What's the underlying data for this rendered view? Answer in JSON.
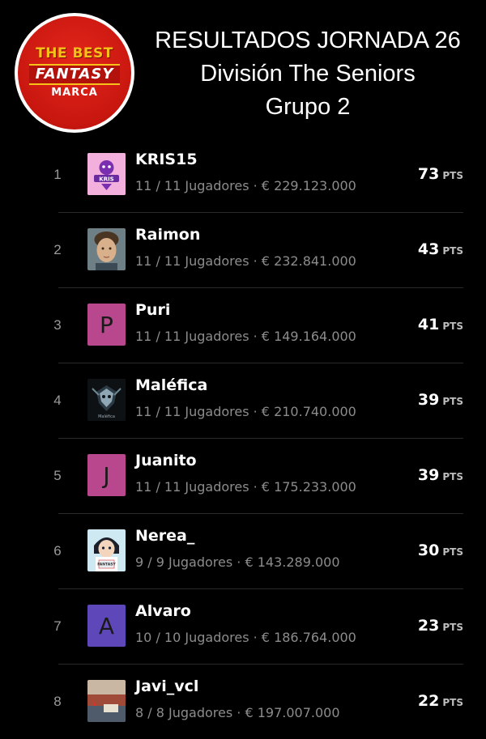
{
  "logo": {
    "line1": "THE BEST",
    "line2": "FANTASY",
    "line3": "MARCA"
  },
  "header": {
    "line1": "RESULTADOS JORNADA 26",
    "line2": "División The Seniors",
    "line3": "Grupo 2"
  },
  "pts_unit": "PTS",
  "rows": [
    {
      "rank": "1",
      "name": "KRIS15",
      "meta": "11 / 11 Jugadores · € 229.123.000",
      "points": "73",
      "avatar": "kris-logo-icon"
    },
    {
      "rank": "2",
      "name": "Raimon",
      "meta": "11 / 11 Jugadores · € 232.841.000",
      "points": "43",
      "avatar": "boy-photo-icon"
    },
    {
      "rank": "3",
      "name": "Puri",
      "meta": "11 / 11 Jugadores · € 149.164.000",
      "points": "41",
      "avatar_letter": "P"
    },
    {
      "rank": "4",
      "name": "Maléfica",
      "meta": "11 / 11 Jugadores · € 210.740.000",
      "points": "39",
      "avatar": "dark-emblem-icon"
    },
    {
      "rank": "5",
      "name": "Juanito",
      "meta": "11 / 11 Jugadores · € 175.233.000",
      "points": "39",
      "avatar_letter": "J"
    },
    {
      "rank": "6",
      "name": "Nerea_",
      "meta": "9 / 9 Jugadores · € 143.289.000",
      "points": "30",
      "avatar": "anime-girl-icon"
    },
    {
      "rank": "7",
      "name": "Alvaro",
      "meta": "10 / 10 Jugadores · € 186.764.000",
      "points": "23",
      "avatar_letter": "A"
    },
    {
      "rank": "8",
      "name": "Javi_vcl",
      "meta": "8 / 8 Jugadores · € 197.007.000",
      "points": "22",
      "avatar": "stadium-photo-icon"
    }
  ]
}
